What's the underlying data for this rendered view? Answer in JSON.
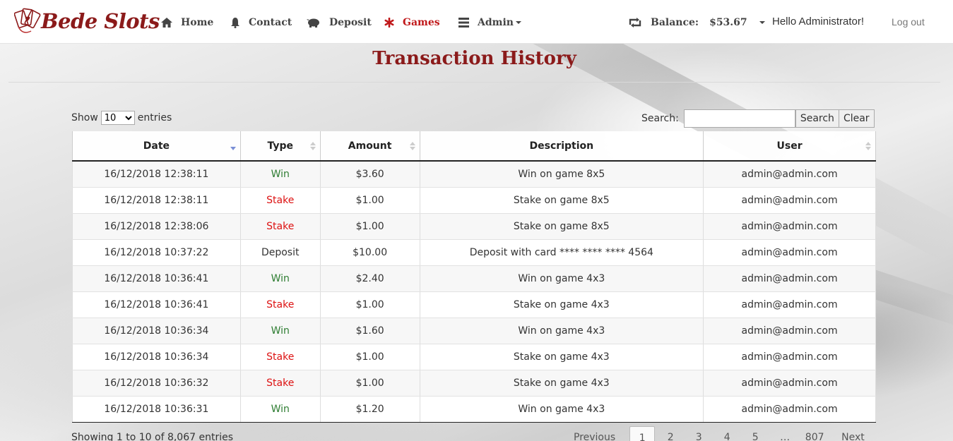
{
  "app": {
    "brand": "Bede Slots"
  },
  "nav": {
    "home": "Home",
    "contact": "Contact",
    "deposit": "Deposit",
    "games": "Games",
    "admin": "Admin",
    "balance_label": "Balance:",
    "balance_value": "$53.67",
    "hello": "Hello Administrator!",
    "logout": "Log out"
  },
  "page": {
    "title": "Transaction History"
  },
  "controls": {
    "show_label": "Show",
    "entries_label": "entries",
    "page_length": "10",
    "search_label": "Search:",
    "search_value": "",
    "search_button": "Search",
    "clear_button": "Clear"
  },
  "table": {
    "columns": [
      "Date",
      "Type",
      "Amount",
      "Description",
      "User"
    ],
    "rows": [
      {
        "date": "16/12/2018 12:38:11",
        "type": "Win",
        "amount": "$3.60",
        "description": "Win on game 8x5",
        "user": "admin@admin.com"
      },
      {
        "date": "16/12/2018 12:38:11",
        "type": "Stake",
        "amount": "$1.00",
        "description": "Stake on game 8x5",
        "user": "admin@admin.com"
      },
      {
        "date": "16/12/2018 12:38:06",
        "type": "Stake",
        "amount": "$1.00",
        "description": "Stake on game 8x5",
        "user": "admin@admin.com"
      },
      {
        "date": "16/12/2018 10:37:22",
        "type": "Deposit",
        "amount": "$10.00",
        "description": "Deposit with card **** **** **** 4564",
        "user": "admin@admin.com"
      },
      {
        "date": "16/12/2018 10:36:41",
        "type": "Win",
        "amount": "$2.40",
        "description": "Win on game 4x3",
        "user": "admin@admin.com"
      },
      {
        "date": "16/12/2018 10:36:41",
        "type": "Stake",
        "amount": "$1.00",
        "description": "Stake on game 4x3",
        "user": "admin@admin.com"
      },
      {
        "date": "16/12/2018 10:36:34",
        "type": "Win",
        "amount": "$1.60",
        "description": "Win on game 4x3",
        "user": "admin@admin.com"
      },
      {
        "date": "16/12/2018 10:36:34",
        "type": "Stake",
        "amount": "$1.00",
        "description": "Stake on game 4x3",
        "user": "admin@admin.com"
      },
      {
        "date": "16/12/2018 10:36:32",
        "type": "Stake",
        "amount": "$1.00",
        "description": "Stake on game 4x3",
        "user": "admin@admin.com"
      },
      {
        "date": "16/12/2018 10:36:31",
        "type": "Win",
        "amount": "$1.20",
        "description": "Win on game 4x3",
        "user": "admin@admin.com"
      }
    ]
  },
  "footer": {
    "info": "Showing 1 to 10 of 8,067 entries",
    "previous": "Previous",
    "pages": [
      "1",
      "2",
      "3",
      "4",
      "5"
    ],
    "ellipsis": "…",
    "last_page": "807",
    "next": "Next",
    "current_page": "1"
  },
  "colors": {
    "brand": "#8b1a1a",
    "active_nav": "#c0181a",
    "win": "#2e7d32",
    "stake": "#dd1111"
  }
}
